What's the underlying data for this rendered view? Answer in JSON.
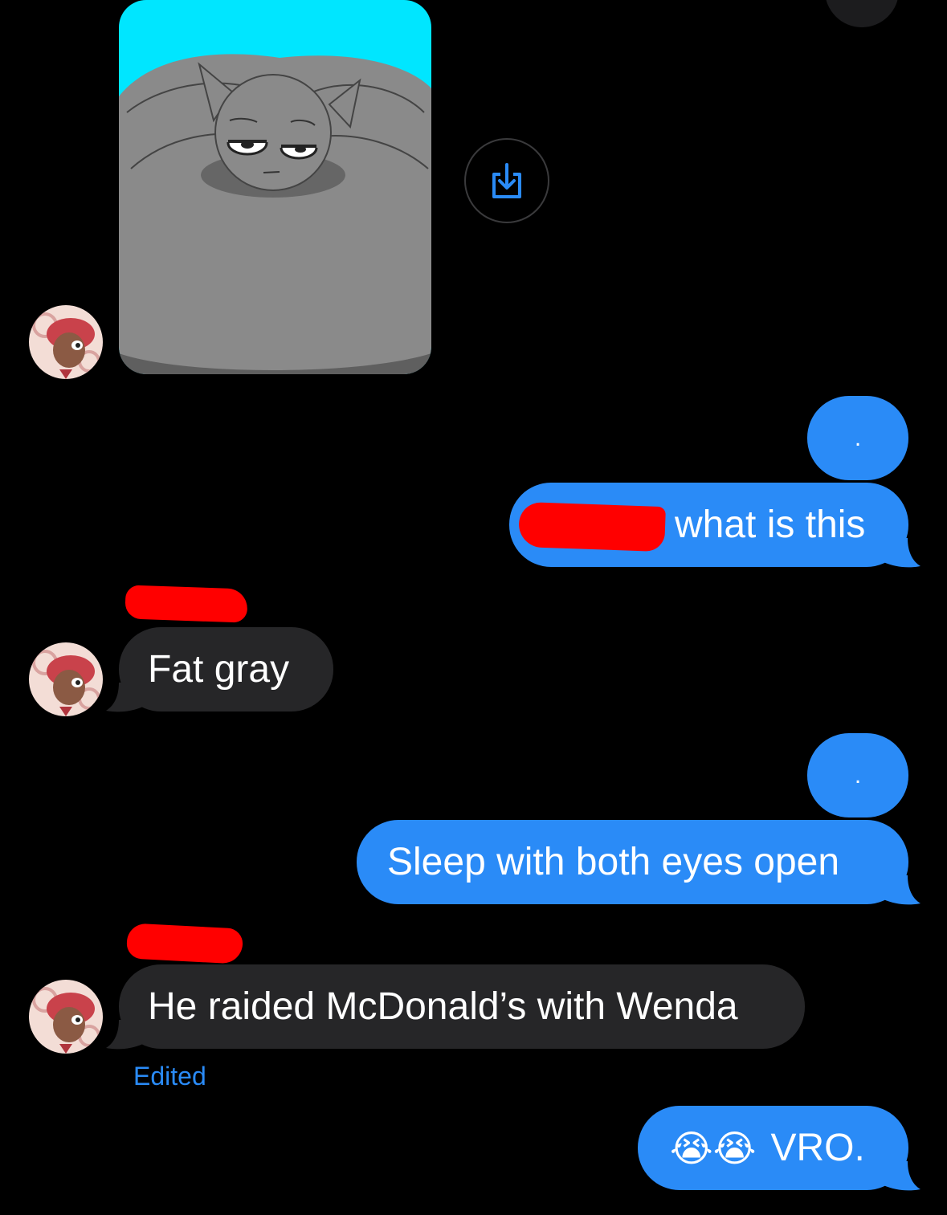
{
  "conversation": {
    "messages": [
      {
        "id": "m1",
        "direction": "incoming",
        "type": "image",
        "image_desc": "gray-cat-blob-image"
      },
      {
        "id": "m2",
        "direction": "outgoing",
        "text": "."
      },
      {
        "id": "m3",
        "direction": "outgoing",
        "text": "what is this",
        "redacted_prefix": true
      },
      {
        "id": "m4",
        "direction": "incoming",
        "text": "Fat gray",
        "sender_redacted": true
      },
      {
        "id": "m5",
        "direction": "outgoing",
        "text": "."
      },
      {
        "id": "m6",
        "direction": "outgoing",
        "text": "Sleep with both eyes open"
      },
      {
        "id": "m7",
        "direction": "incoming",
        "text": "He raided McDonald’s with Wenda",
        "sender_redacted": true,
        "status": "Edited"
      },
      {
        "id": "m8",
        "direction": "outgoing",
        "emoji": "😭😭",
        "text": "VRO."
      }
    ]
  },
  "colors": {
    "background": "#000000",
    "sent_bubble": "#2a8bf7",
    "received_bubble": "#262628",
    "edited_text": "#2a8bf7",
    "redaction": "#ff0000"
  },
  "icons": {
    "save_button": "save-download-icon",
    "avatar": "contact-avatar"
  }
}
